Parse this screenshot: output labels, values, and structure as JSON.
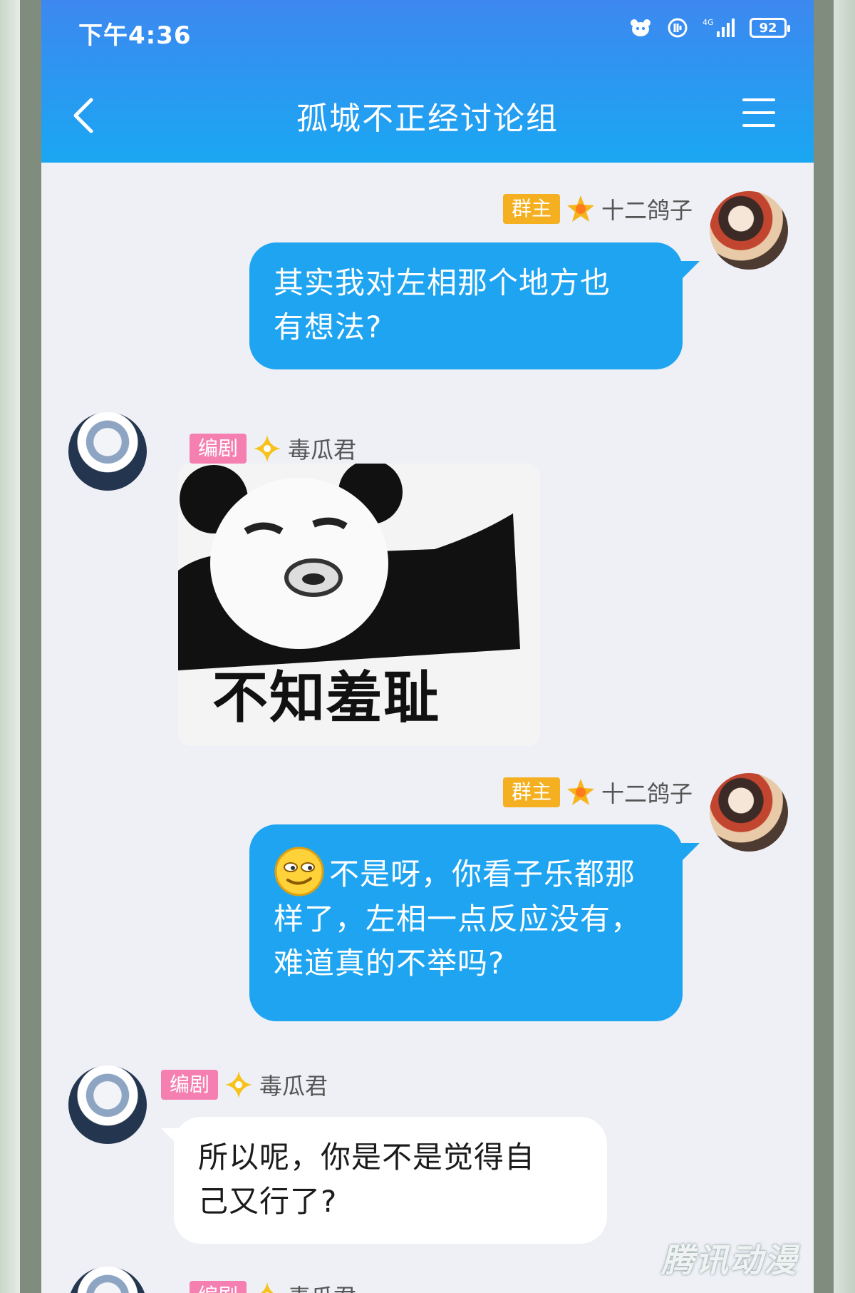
{
  "status_bar": {
    "time": "下午4:36",
    "network": "4G",
    "battery": "92"
  },
  "header": {
    "title": "孤城不正经讨论组",
    "back_icon": "chevron-left-icon",
    "menu_icon": "hamburger-menu-icon"
  },
  "messages": [
    {
      "direction": "outgoing",
      "badge": "群主",
      "sender": "十二鸽子",
      "text_line1": "其实我对左相那个地方也",
      "text_line2": "有想法?"
    },
    {
      "direction": "incoming",
      "badge": "编剧",
      "sender": "毒瓜君",
      "sticker_caption": "不知羞耻"
    },
    {
      "direction": "outgoing",
      "badge": "群主",
      "sender": "十二鸽子",
      "text_line1": "不是呀，你看子乐都那",
      "text_line2": "样了，左相一点反应没有，",
      "text_line3": "难道真的不举吗?"
    },
    {
      "direction": "incoming",
      "badge": "编剧",
      "sender": "毒瓜君",
      "text_line1": "所以呢，你是不是觉得自",
      "text_line2": "己又行了?"
    },
    {
      "direction": "incoming",
      "badge": "编剧",
      "sender": "毒瓜君"
    }
  ],
  "watermark": "腾讯动漫",
  "colors": {
    "header_start": "#3d88f0",
    "header_end": "#1aa7f2",
    "outgoing_bubble": "#1ea4f0",
    "incoming_bubble": "#ffffff",
    "owner_badge": "#f5b021",
    "writer_badge": "#f47fb0"
  }
}
